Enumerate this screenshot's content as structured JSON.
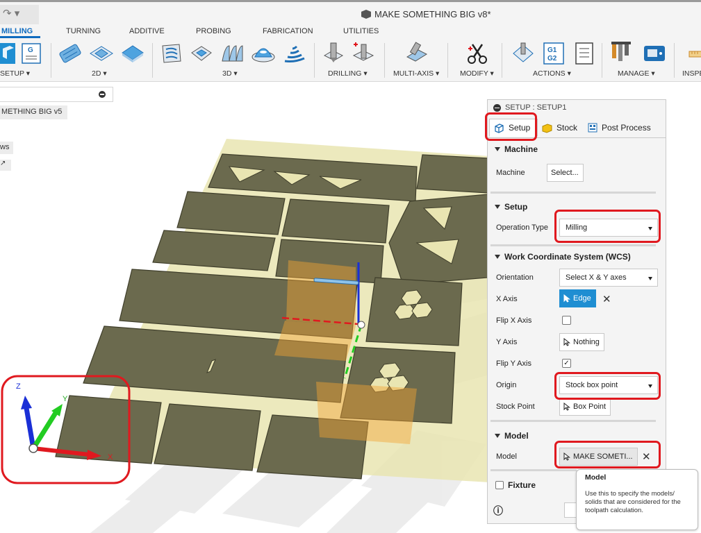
{
  "window": {
    "quick_access": "↷ ▾",
    "document_title": "MAKE SOMETHING BIG v8*"
  },
  "ribbon_tabs": [
    "MILLING",
    "TURNING",
    "ADDITIVE",
    "PROBING",
    "FABRICATION",
    "UTILITIES"
  ],
  "ribbon_groups": {
    "setup": "SETUP ▾",
    "two_d": "2D ▾",
    "three_d": "3D ▾",
    "drilling": "DRILLING ▾",
    "multi_axis": "MULTI-AXIS ▾",
    "modify": "MODIFY ▾",
    "actions": "ACTIONS ▾",
    "manage": "MANAGE ▾",
    "inspect": "INSPE"
  },
  "ribbon_icon_text": {
    "gcode": "G",
    "g1g2_top": "G1",
    "g1g2_bottom": "G2"
  },
  "browser": {
    "root": "METHING BIG v5",
    "views": "ws",
    "origin": "↗"
  },
  "dialog": {
    "title": "SETUP : SETUP1",
    "tabs": {
      "setup": "Setup",
      "stock": "Stock",
      "post_process": "Post Process"
    },
    "machine": {
      "header": "Machine",
      "machine_label": "Machine",
      "machine_button": "Select..."
    },
    "setup": {
      "header": "Setup",
      "operation_type_label": "Operation Type",
      "operation_type_value": "Milling"
    },
    "wcs": {
      "header": "Work Coordinate System (WCS)",
      "orientation_label": "Orientation",
      "orientation_value": "Select X & Y axes",
      "x_axis_label": "X Axis",
      "x_axis_value": "Edge",
      "flip_x_label": "Flip X Axis",
      "flip_x_checked": false,
      "y_axis_label": "Y Axis",
      "y_axis_value": "Nothing",
      "flip_y_label": "Flip Y Axis",
      "flip_y_checked": true,
      "check_mark": "✓",
      "origin_label": "Origin",
      "origin_value": "Stock box point",
      "stock_point_label": "Stock Point",
      "stock_point_value": "Box Point"
    },
    "model": {
      "header": "Model",
      "model_label": "Model",
      "model_value": "MAKE SOMETI..."
    },
    "fixture": {
      "header": "Fixture"
    },
    "clear_symbol": "✕",
    "info_symbol": "ⓘ"
  },
  "tooltip": {
    "title": "Model",
    "body": "Use this to specify the models/ solids that are considered for the toolpath calculation."
  },
  "triad_labels": {
    "z": "Z",
    "y": "Y",
    "x": "X"
  },
  "colors": {
    "accent_blue": "#0f6bbf",
    "selection_blue": "#1f8ed2",
    "highlight_red": "#e0191f",
    "part_olive": "#6b6a4e",
    "sheet_yellow": "#e9e5b2"
  }
}
